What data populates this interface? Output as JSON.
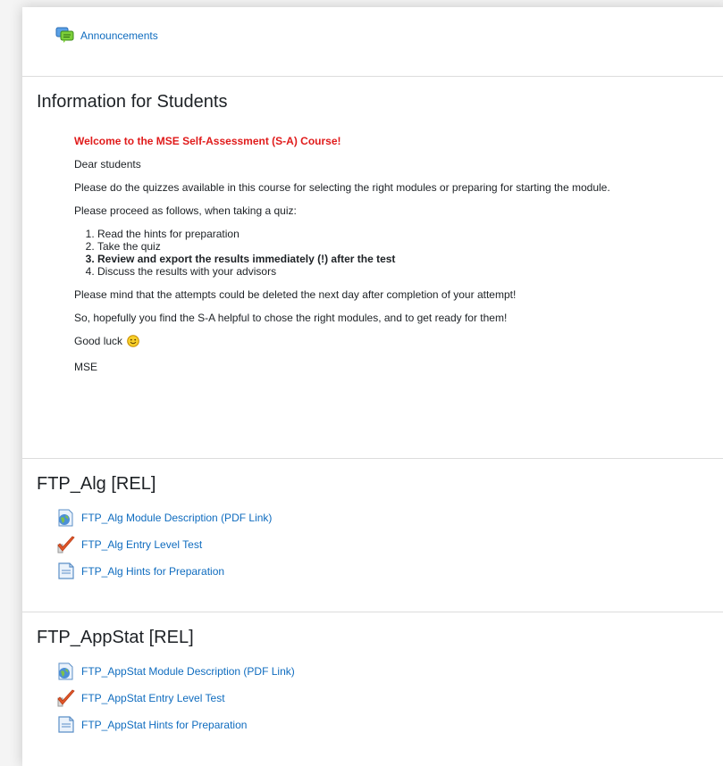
{
  "announcements": {
    "label": "Announcements",
    "icon": "forum-icon"
  },
  "info_section": {
    "title": "Information for Students",
    "welcome": "Welcome to the MSE Self-Assessment (S-A) Course!",
    "p1": "Dear students",
    "p2": "Please do the quizzes available in this course for selecting the right modules or preparing for starting the module.",
    "p3": "Please proceed as follows, when taking a quiz:",
    "steps": [
      "Read the hints for preparation",
      "Take the quiz",
      "Review and export the results immediately (!) after the test",
      "Discuss the results with your advisors"
    ],
    "p4": "Please mind that the attempts could be deleted the next day after completion of your attempt!",
    "p5": "So, hopefully you find the S-A helpful to chose the right modules, and to get ready for them!",
    "p6": "Good luck",
    "p7": "MSE"
  },
  "alg_section": {
    "title": "FTP_Alg [REL]",
    "items": [
      {
        "label": "FTP_Alg Module Description (PDF Link)",
        "icon": "url-globe-icon"
      },
      {
        "label": "FTP_Alg Entry Level Test",
        "icon": "quiz-checkmark-icon"
      },
      {
        "label": "FTP_Alg Hints for Preparation",
        "icon": "page-icon"
      }
    ]
  },
  "appstat_section": {
    "title": "FTP_AppStat [REL]",
    "items": [
      {
        "label": "FTP_AppStat Module Description (PDF Link)",
        "icon": "url-globe-icon"
      },
      {
        "label": "FTP_AppStat Entry Level Test",
        "icon": "quiz-checkmark-icon"
      },
      {
        "label": "FTP_AppStat Hints for Preparation",
        "icon": "page-icon"
      }
    ]
  },
  "colors": {
    "link": "#0f6cbf",
    "welcome": "#e01b1b",
    "divider": "#dcdcdc"
  }
}
